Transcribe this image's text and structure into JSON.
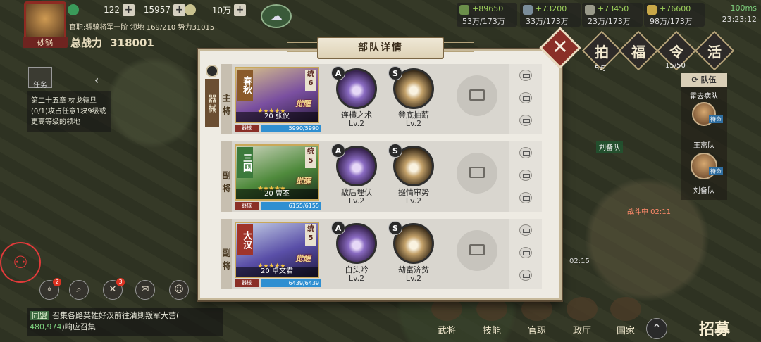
{
  "player": {
    "name": "砂锅",
    "rank": "官职:骠骑将军一阶 领地 169/210 势力31015",
    "power_label": "总战力",
    "power_value": "318001"
  },
  "top_resources": [
    {
      "value": "122"
    },
    {
      "value": "15957"
    },
    {
      "value": "10万"
    }
  ],
  "right_resources": [
    {
      "delta": "+89650",
      "amount": "53万/173万"
    },
    {
      "delta": "+73200",
      "amount": "33万/173万"
    },
    {
      "delta": "+73450",
      "amount": "23万/173万"
    },
    {
      "delta": "+76600",
      "amount": "98万/173万"
    }
  ],
  "status": {
    "net": "100ms",
    "time": "23:23:12"
  },
  "events": [
    {
      "label": "拍",
      "sub": "5时"
    },
    {
      "label": "福",
      "sub": ""
    },
    {
      "label": "令",
      "sub": "15/50"
    },
    {
      "label": "活",
      "sub": ""
    }
  ],
  "quest": {
    "title": "任务",
    "text": "第二十五章 枕戈待旦 (0/1)攻占任意1块9级或更高等级的领地"
  },
  "chat": {
    "tag": "同盟",
    "text": "召集各路英雄好汉前往清剿叛军大营(",
    "num": "480,974",
    "tail": ")响应召集"
  },
  "bottom_nav": [
    "武将",
    "技能",
    "官职",
    "政厅",
    "国家"
  ],
  "recruit": "招募",
  "team_panel": {
    "title": "队伍",
    "members": [
      {
        "name": "霍去病队",
        "status": "待命"
      },
      {
        "name": "王离队",
        "status": "待命"
      },
      {
        "name": "刘备队",
        "status": ""
      }
    ]
  },
  "map_labels": {
    "team": "刘备队",
    "timer1": "战斗中 02:11",
    "timer2": "02:15"
  },
  "modal": {
    "title": "部队详情",
    "mechanism_label": "器械",
    "rows": [
      {
        "role": "主将",
        "faction": "春秋",
        "cost": "统6",
        "awake": "觉醒",
        "level": "20",
        "hero": "张仪",
        "stars": "★★★★★",
        "mini_btn": "器械",
        "hp": "5990/5990",
        "hp_ratio": 1.0,
        "art_color": "#7a4fa0",
        "skills": [
          {
            "grade": "A",
            "name": "连横之术",
            "lv": "Lv.2"
          },
          {
            "grade": "S",
            "name": "釜底抽薪",
            "lv": "Lv.2"
          }
        ]
      },
      {
        "role": "副将",
        "faction": "三国",
        "cost": "统5",
        "awake": "觉醒",
        "level": "20",
        "hero": "曹丕",
        "stars": "★★★★★",
        "mini_btn": "器械",
        "hp": "6155/6155",
        "hp_ratio": 1.0,
        "art_color": "#4f8a3c",
        "skills": [
          {
            "grade": "A",
            "name": "敌后埋伏",
            "lv": "Lv.2"
          },
          {
            "grade": "S",
            "name": "掇情审势",
            "lv": "Lv.2"
          }
        ]
      },
      {
        "role": "副将",
        "faction": "大汉",
        "cost": "统5",
        "awake": "觉醒",
        "level": "20",
        "hero": "卓文君",
        "stars": "★★★★★",
        "mini_btn": "器械",
        "hp": "6439/6439",
        "hp_ratio": 1.0,
        "art_color": "#5a4fa8",
        "skills": [
          {
            "grade": "A",
            "name": "白头吟",
            "lv": "Lv.2"
          },
          {
            "grade": "S",
            "name": "劫富济贫",
            "lv": "Lv.2"
          }
        ]
      }
    ]
  }
}
